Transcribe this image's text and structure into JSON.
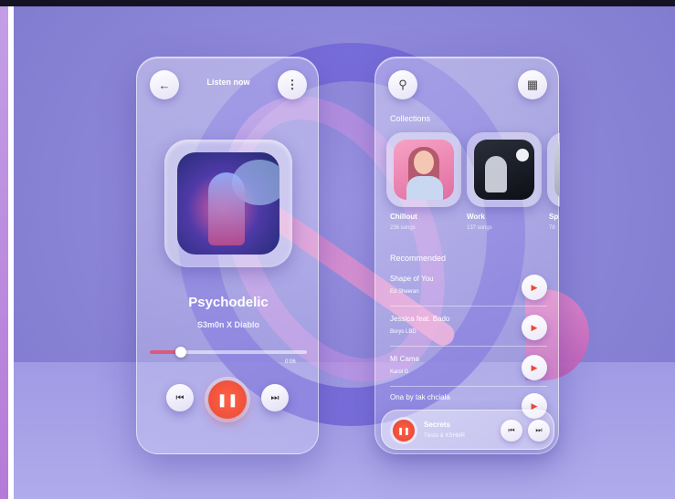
{
  "colors": {
    "accent": "#e84a34",
    "background": "#8d87d9",
    "progress": "#d95a7c"
  },
  "player": {
    "back_icon": "arrow-left-icon",
    "header_title": "Listen now",
    "menu_icon": "more-vertical-icon",
    "song_title": "Psychodelic",
    "song_artist": "S3m0n X Diablo",
    "progress_fraction": 0.2,
    "time_remaining": "0:06",
    "prev_icon": "skip-previous-icon",
    "play_icon": "pause-icon",
    "next_icon": "skip-next-icon"
  },
  "browse": {
    "search_icon": "search-icon",
    "grid_icon": "grid-icon",
    "collections_label": "Collections",
    "collections": [
      {
        "title": "Chillout",
        "subtitle": "236 songs"
      },
      {
        "title": "Work",
        "subtitle": "137 songs"
      },
      {
        "title": "Sp",
        "subtitle": "78"
      }
    ],
    "recommended_label": "Recommended",
    "tracks": [
      {
        "name": "Shape of You",
        "artist": "Ed Sheeran"
      },
      {
        "name": "Jessica feat. Bado",
        "artist": "Borys LBD"
      },
      {
        "name": "Mi Cama",
        "artist": "Karol G"
      },
      {
        "name": "Ona by tak chciala",
        "artist": ""
      }
    ],
    "mini_player": {
      "name": "Secrets",
      "artist": "Tiesto & KSHMR"
    }
  }
}
